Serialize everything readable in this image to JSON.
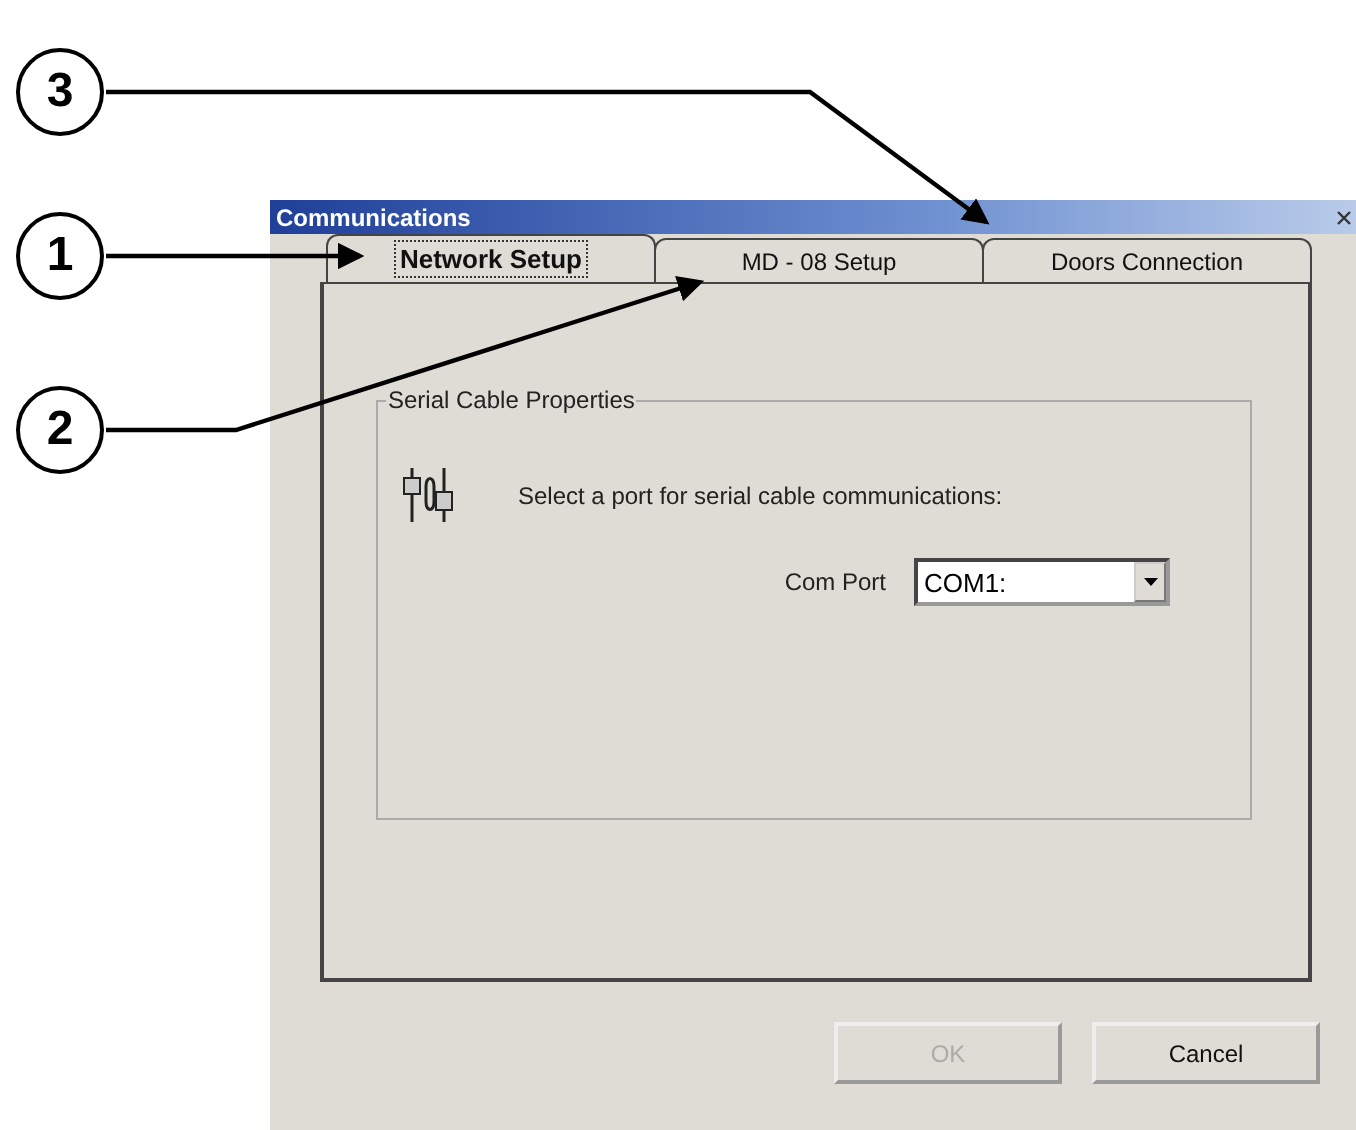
{
  "callouts": [
    {
      "number": "3"
    },
    {
      "number": "1"
    },
    {
      "number": "2"
    }
  ],
  "window": {
    "title": "Communications"
  },
  "tabs": [
    {
      "label": "Network Setup",
      "selected": true
    },
    {
      "label": "MD - 08 Setup",
      "selected": false
    },
    {
      "label": "Doors Connection",
      "selected": false
    }
  ],
  "group": {
    "title": "Serial Cable Properties",
    "prompt": "Select a port for serial cable communications:",
    "com_port": {
      "label": "Com Port",
      "value": "COM1:"
    }
  },
  "buttons": [
    {
      "label": "OK",
      "disabled": true
    },
    {
      "label": "Cancel",
      "disabled": false
    }
  ]
}
